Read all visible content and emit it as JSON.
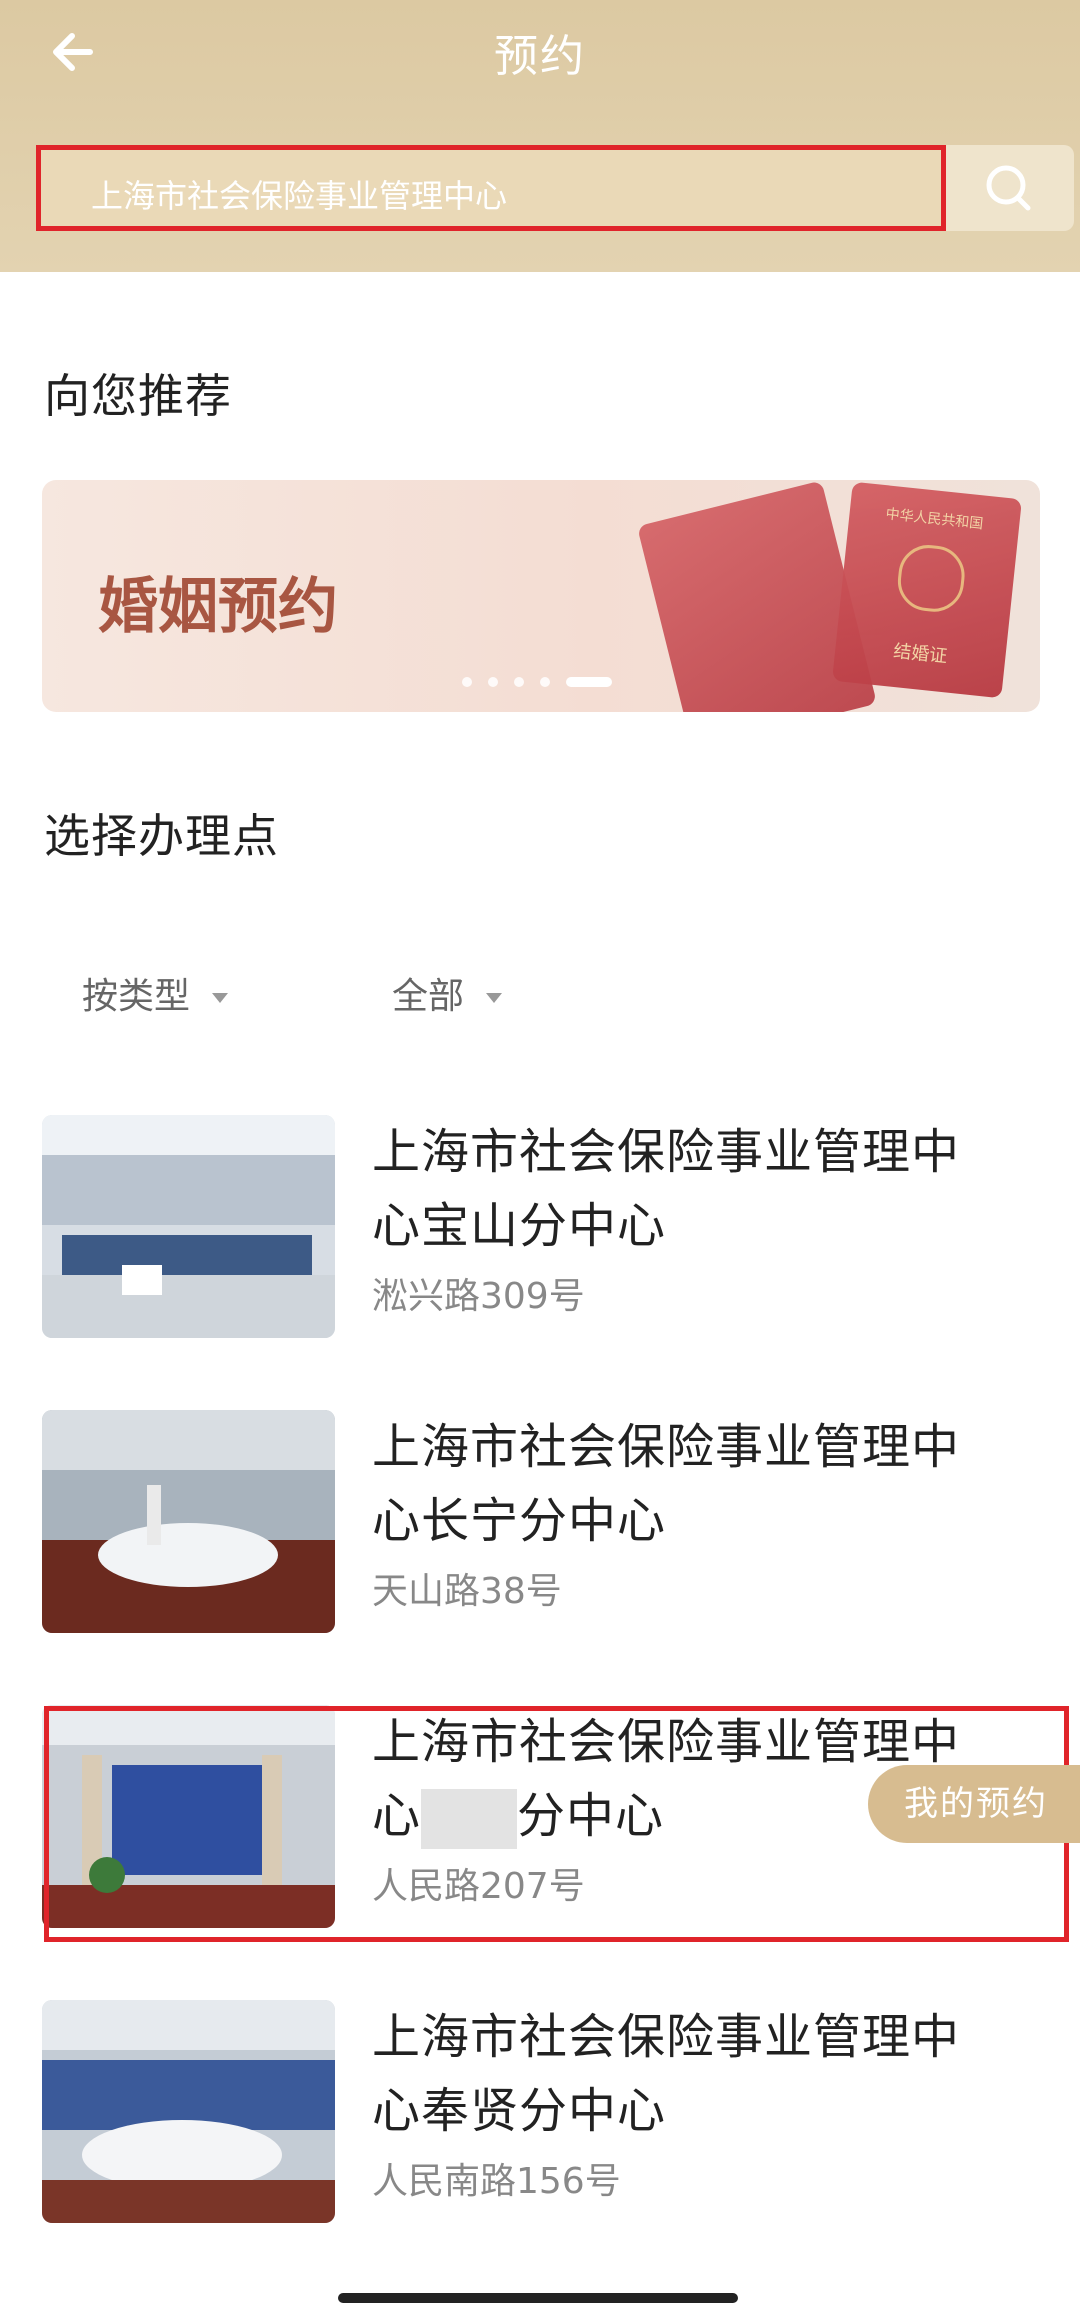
{
  "header": {
    "title": "预约",
    "search_text": "上海市社会保险事业管理中心"
  },
  "recommend": {
    "heading": "向您推荐",
    "banner_title": "婚姻预约",
    "passport_top": "中华人民共和国",
    "passport_bottom": "结婚证",
    "carousel_pages": 5,
    "carousel_active": 5
  },
  "locations": {
    "heading": "选择办理点",
    "filters": [
      {
        "label": "按类型"
      },
      {
        "label": "全部"
      }
    ],
    "items": [
      {
        "name_line1": "上海市社会保险事业管理中",
        "name_line2": "心宝山分中心",
        "address": "淞兴路309号"
      },
      {
        "name_line1": "上海市社会保险事业管理中",
        "name_line2": "心长宁分中心",
        "address": "天山路38号"
      },
      {
        "name_line1": "上海市社会保险事业管理中",
        "name_line2_a": "心",
        "name_line2_b": "分中心",
        "address": "人民路207号"
      },
      {
        "name_line1": "上海市社会保险事业管理中",
        "name_line2": "心奉贤分中心",
        "address": "人民南路156号"
      }
    ]
  },
  "floating": {
    "my_appointment": "我的预约"
  },
  "colors": {
    "header_bg": "#dcc9a2",
    "highlight_red": "#e0242a",
    "accent_gold": "#d7bc90"
  }
}
